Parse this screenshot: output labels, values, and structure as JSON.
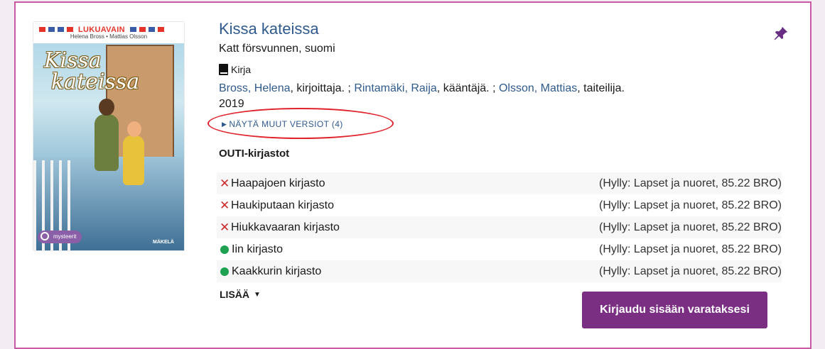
{
  "record": {
    "title": "Kissa kateissa",
    "original_title": "Katt försvunnen, suomi",
    "format": "Kirja",
    "authors": [
      {
        "name": "Bross, Helena",
        "role": ", kirjoittaja. ; "
      },
      {
        "name": "Rintamäki, Raija",
        "role": ", kääntäjä. ; "
      },
      {
        "name": "Olsson, Mattias",
        "role": ", taiteilija."
      }
    ],
    "year": "2019",
    "other_versions": "NÄYTÄ MUUT VERSIOT (4)",
    "icons": {
      "format": "book-icon",
      "pin": "pin-icon"
    }
  },
  "cover": {
    "series": "LUKUAVAIN",
    "authors": "Helena Bross • Mattias Olsson",
    "title_line1": "Kissa",
    "title_line2": "kateissa",
    "badge": "mysteerit",
    "publisher": "MÄKELÄ"
  },
  "holdings": {
    "library_group": "OUTI-kirjastot",
    "rows": [
      {
        "status": "unavailable",
        "name": "Haapajoen kirjasto",
        "shelf": "(Hylly: Lapset ja nuoret, 85.22 BRO)"
      },
      {
        "status": "unavailable",
        "name": "Haukiputaan kirjasto",
        "shelf": "(Hylly: Lapset ja nuoret, 85.22 BRO)"
      },
      {
        "status": "unavailable",
        "name": "Hiukkavaaran kirjasto",
        "shelf": "(Hylly: Lapset ja nuoret, 85.22 BRO)"
      },
      {
        "status": "available",
        "name": "Iin kirjasto",
        "shelf": "(Hylly: Lapset ja nuoret, 85.22 BRO)"
      },
      {
        "status": "available",
        "name": "Kaakkurin kirjasto",
        "shelf": "(Hylly: Lapset ja nuoret, 85.22 BRO)"
      }
    ],
    "more_label": "LISÄÄ"
  },
  "actions": {
    "login_label": "Kirjaudu sisään varataksesi"
  },
  "colors": {
    "link": "#2f5a8c",
    "button": "#7a2f83",
    "unavailable": "#cc2b2b",
    "available": "#1ea150",
    "card_border": "#c95aa6",
    "highlight": "#e0222b"
  }
}
